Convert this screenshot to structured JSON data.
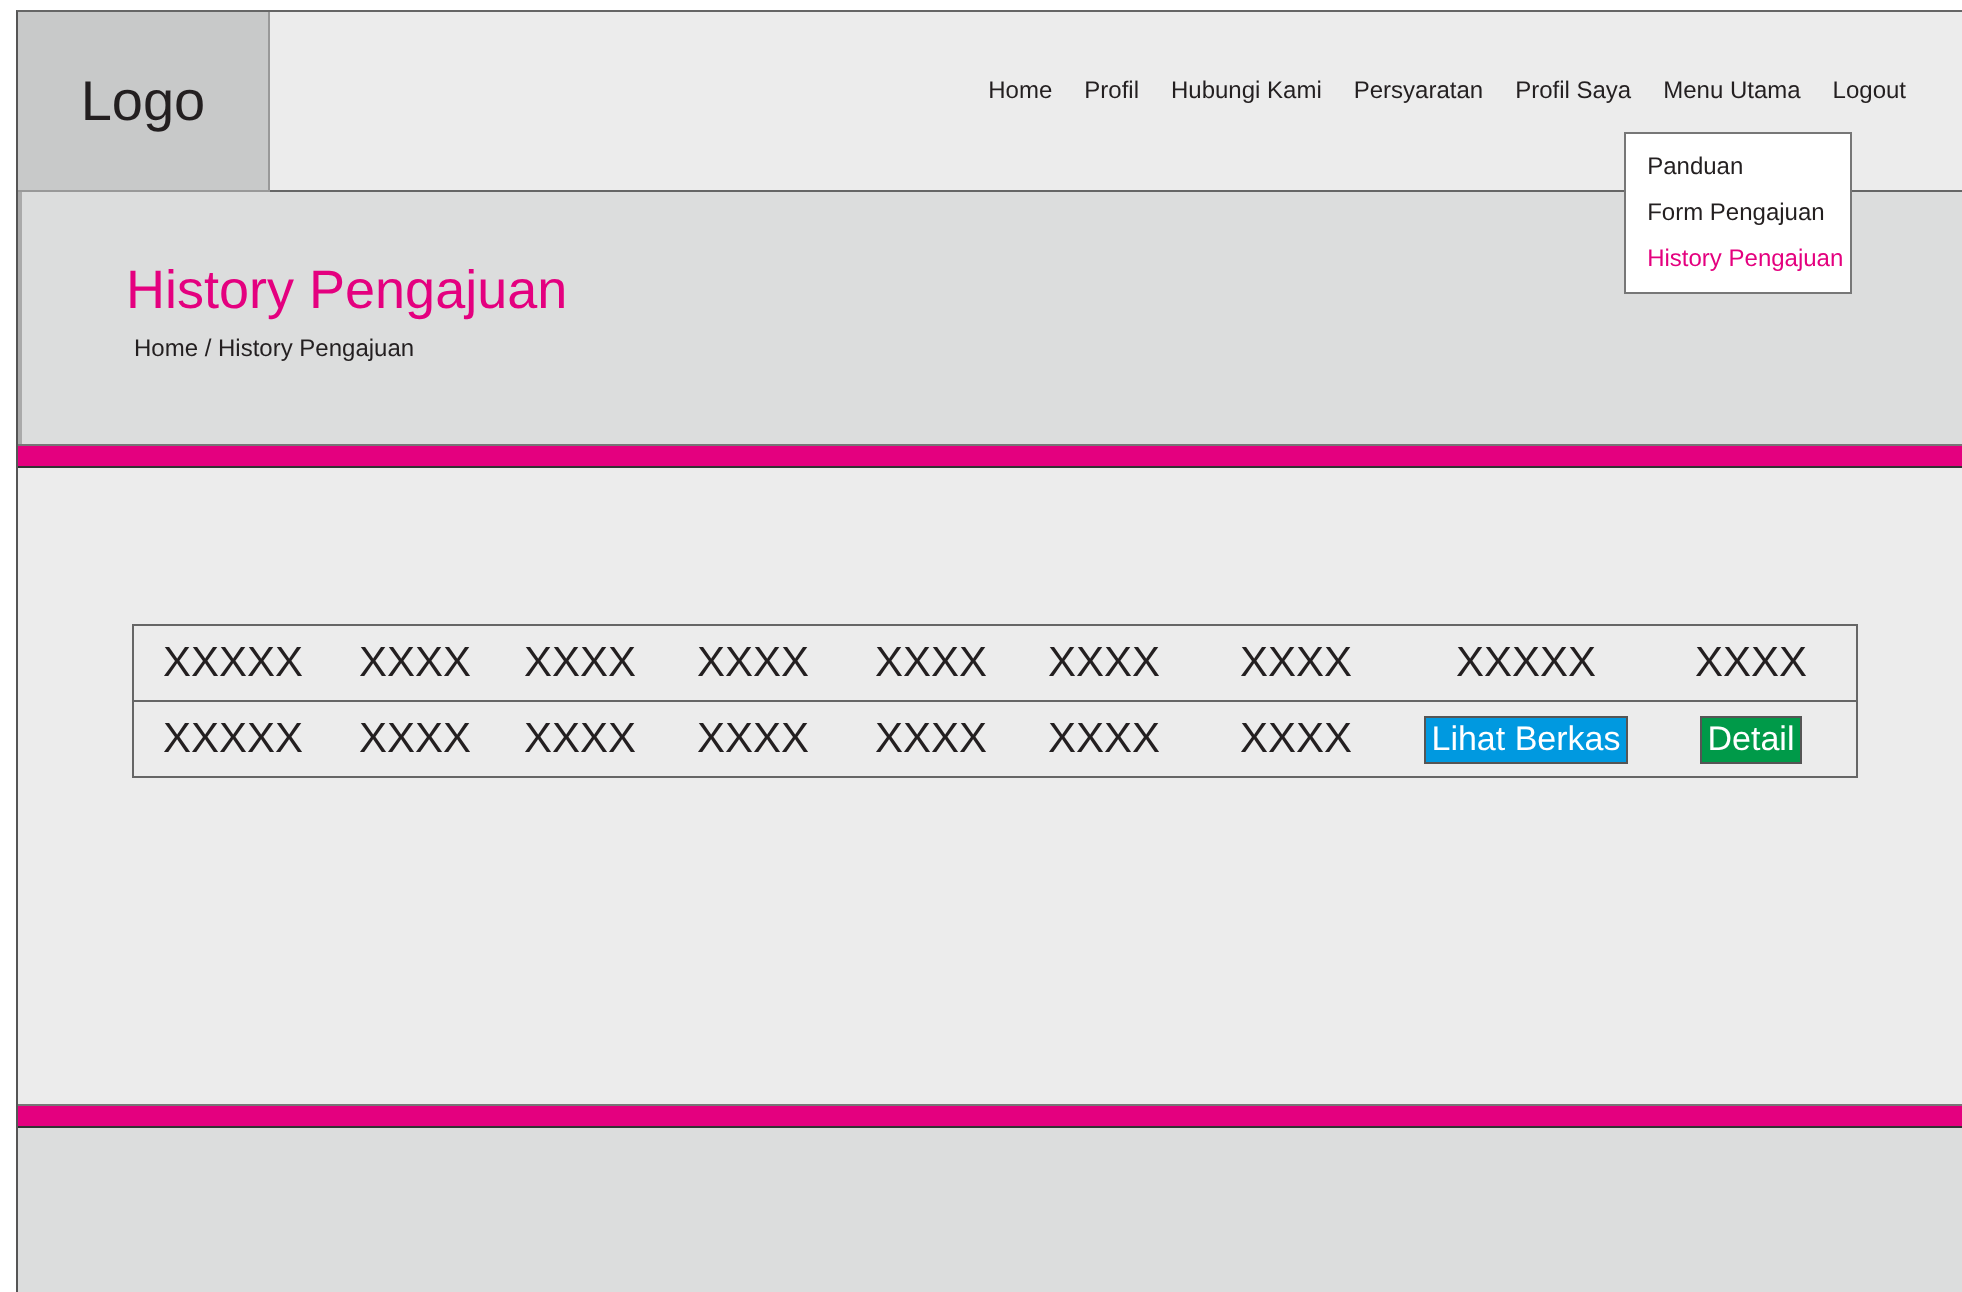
{
  "logo": "Logo",
  "nav": [
    {
      "label": "Home"
    },
    {
      "label": "Profil"
    },
    {
      "label": "Hubungi Kami"
    },
    {
      "label": "Persyaratan"
    },
    {
      "label": "Profil Saya"
    },
    {
      "label": "Menu Utama",
      "expanded": true
    },
    {
      "label": "Logout"
    }
  ],
  "dropdown": [
    {
      "label": "Panduan",
      "selected": false
    },
    {
      "label": "Form Pengajuan",
      "selected": false
    },
    {
      "label": "History Pengajuan",
      "selected": true
    }
  ],
  "page_title": "History Pengajuan",
  "breadcrumb": "Home / History Pengajuan",
  "table": {
    "rows": [
      {
        "cells": [
          {
            "kind": "text",
            "text": "XXXXX"
          },
          {
            "kind": "text",
            "text": "XXXX"
          },
          {
            "kind": "text",
            "text": "XXXX"
          },
          {
            "kind": "text",
            "text": "XXXX"
          },
          {
            "kind": "text",
            "text": "XXXX"
          },
          {
            "kind": "text",
            "text": "XXXX"
          },
          {
            "kind": "text",
            "text": "XXXX"
          },
          {
            "kind": "text",
            "text": "XXXXX"
          },
          {
            "kind": "text",
            "text": "XXXX"
          }
        ]
      },
      {
        "cells": [
          {
            "kind": "text",
            "text": "XXXXX"
          },
          {
            "kind": "text",
            "text": "XXXX"
          },
          {
            "kind": "text",
            "text": "XXXX"
          },
          {
            "kind": "text",
            "text": "XXXX"
          },
          {
            "kind": "text",
            "text": "XXXX"
          },
          {
            "kind": "text",
            "text": "XXXX"
          },
          {
            "kind": "text",
            "text": "XXXX"
          },
          {
            "kind": "button",
            "text": "Lihat Berkas",
            "color": "#0099e0"
          },
          {
            "kind": "button",
            "text": "Detail",
            "color": "#009a49"
          }
        ]
      }
    ]
  }
}
